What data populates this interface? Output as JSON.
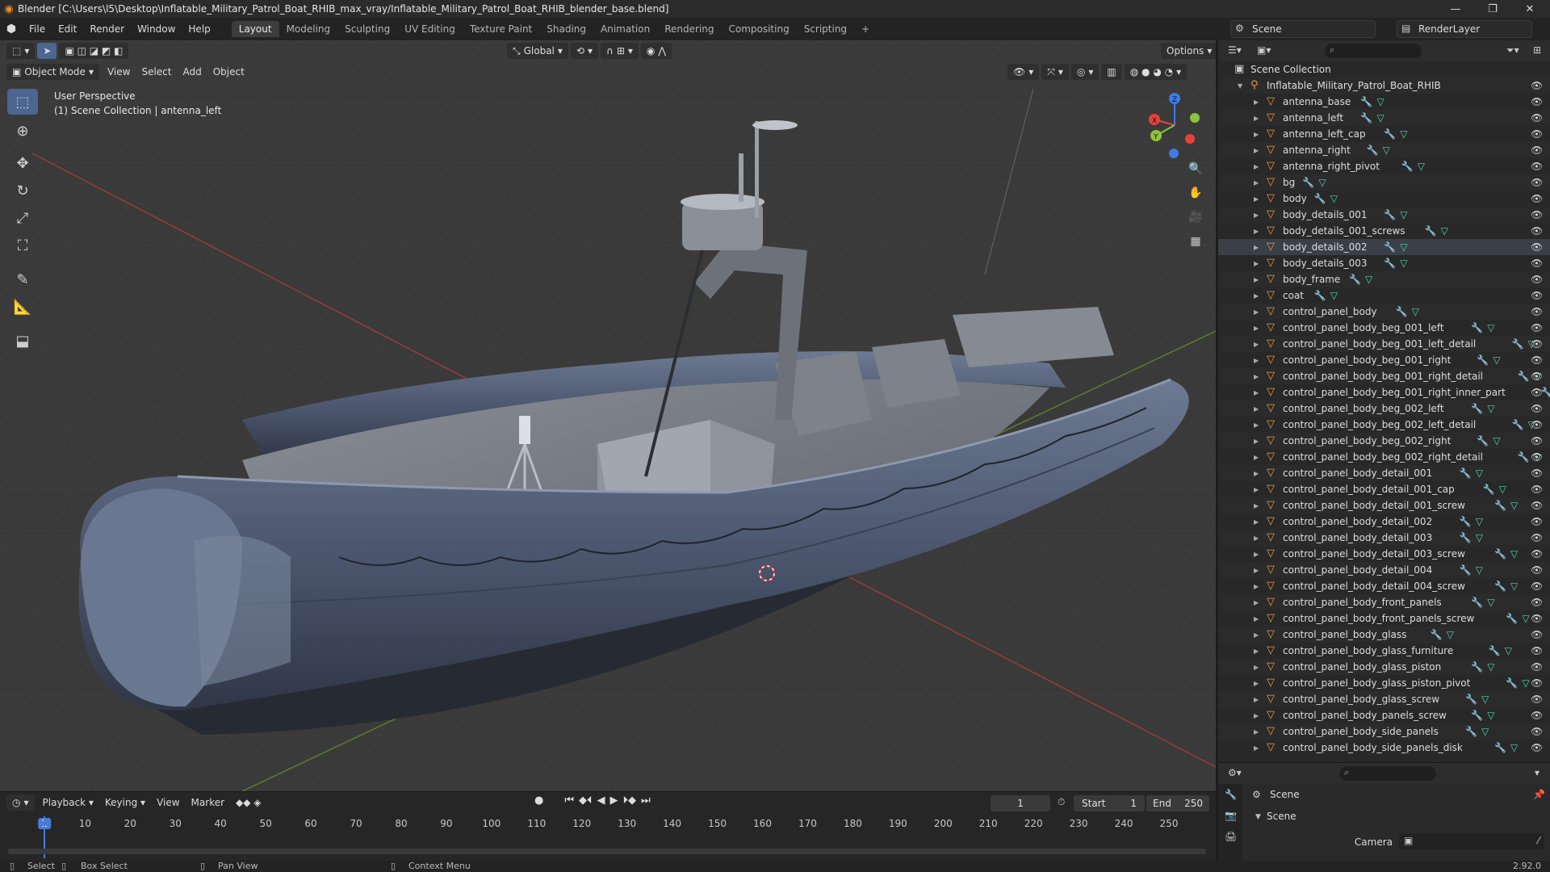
{
  "window": {
    "title": "Blender [C:\\Users\\l5\\Desktop\\Inflatable_Military_Patrol_Boat_RHIB_max_vray/Inflatable_Military_Patrol_Boat_RHIB_blender_base.blend]",
    "minimize": "—",
    "maximize": "❐",
    "close": "✕"
  },
  "menu": [
    "File",
    "Edit",
    "Render",
    "Window",
    "Help"
  ],
  "workspaces": [
    "Layout",
    "Modeling",
    "Sculpting",
    "UV Editing",
    "Texture Paint",
    "Shading",
    "Animation",
    "Rendering",
    "Compositing",
    "Scripting"
  ],
  "workspace_add": "+",
  "active_workspace": "Layout",
  "scene": {
    "name": "Scene",
    "render_layer": "RenderLayer"
  },
  "viewport": {
    "mode": "Object Mode",
    "menus": [
      "View",
      "Select",
      "Add",
      "Object"
    ],
    "transform_orientation": "Global",
    "options_label": "Options",
    "perspective_label": "User Perspective",
    "collection_label": "(1) Scene Collection | antenna_left",
    "gizmo_axes": {
      "x": "X",
      "y": "Y",
      "z": "Z"
    }
  },
  "outliner": {
    "root": "Scene Collection",
    "collection": "Inflatable_Military_Patrol_Boat_RHIB",
    "selected": "body_details_002",
    "objects": [
      "antenna_base",
      "antenna_left",
      "antenna_left_cap",
      "antenna_right",
      "antenna_right_pivot",
      "bg",
      "body",
      "body_details_001",
      "body_details_001_screws",
      "body_details_002",
      "body_details_003",
      "body_frame",
      "coat",
      "control_panel_body",
      "control_panel_body_beg_001_left",
      "control_panel_body_beg_001_left_detail",
      "control_panel_body_beg_001_right",
      "control_panel_body_beg_001_right_detail",
      "control_panel_body_beg_001_right_inner_part",
      "control_panel_body_beg_002_left",
      "control_panel_body_beg_002_left_detail",
      "control_panel_body_beg_002_right",
      "control_panel_body_beg_002_right_detail",
      "control_panel_body_detail_001",
      "control_panel_body_detail_001_cap",
      "control_panel_body_detail_001_screw",
      "control_panel_body_detail_002",
      "control_panel_body_detail_003",
      "control_panel_body_detail_003_screw",
      "control_panel_body_detail_004",
      "control_panel_body_detail_004_screw",
      "control_panel_body_front_panels",
      "control_panel_body_front_panels_screw",
      "control_panel_body_glass",
      "control_panel_body_glass_furniture",
      "control_panel_body_glass_piston",
      "control_panel_body_glass_piston_pivot",
      "control_panel_body_glass_screw",
      "control_panel_body_panels_screw",
      "control_panel_body_side_panels",
      "control_panel_body_side_panels_disk"
    ]
  },
  "properties": {
    "scene_title": "Scene",
    "panel_title": "Scene",
    "camera_label": "Camera"
  },
  "timeline": {
    "menus": [
      "Playback",
      "Keying",
      "View",
      "Marker"
    ],
    "current_frame": "1",
    "start_label": "Start",
    "start": "1",
    "end_label": "End",
    "end": "250",
    "ticks": [
      "1",
      "10",
      "20",
      "30",
      "40",
      "50",
      "60",
      "70",
      "80",
      "90",
      "100",
      "110",
      "120",
      "130",
      "140",
      "150",
      "160",
      "170",
      "180",
      "190",
      "200",
      "210",
      "220",
      "230",
      "240",
      "250"
    ]
  },
  "statusbar": {
    "select": "Select",
    "box_select": "Box Select",
    "pan_view": "Pan View",
    "context_menu": "Context Menu",
    "version": "2.92.0"
  },
  "colors": {
    "accent": "#4b6690",
    "object_icon": "#f29a3a",
    "mesh_icon": "#4fd7b3",
    "modifier_icon": "#7aa7e8",
    "axis_x": "#e8413d",
    "axis_y": "#8bc43c",
    "axis_z": "#3d7be8"
  }
}
